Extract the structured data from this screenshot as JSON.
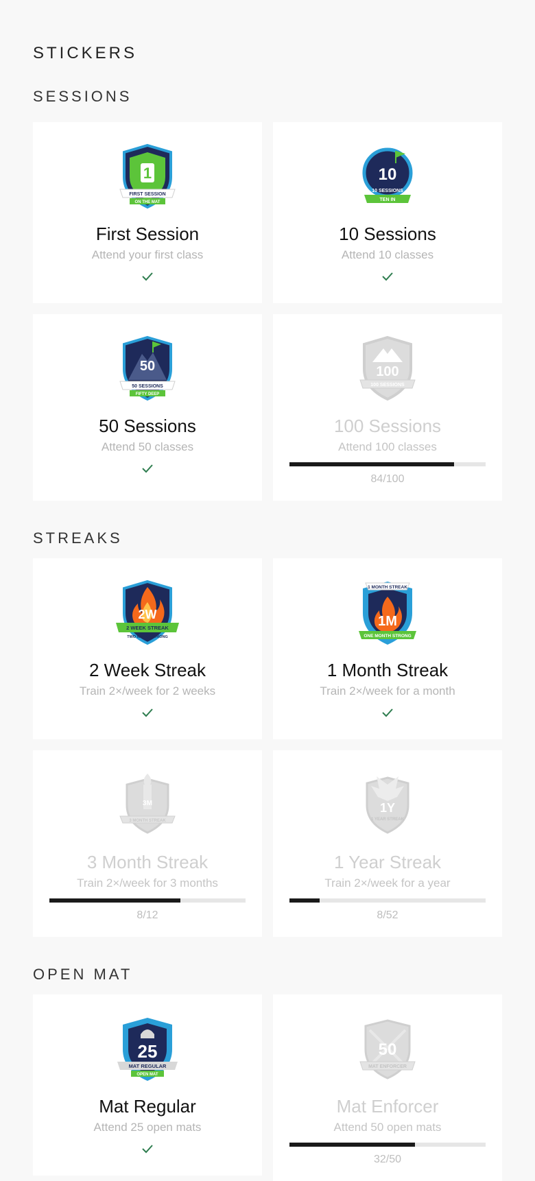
{
  "page": {
    "title": "STICKERS"
  },
  "sections": {
    "sessions": {
      "title": "SESSIONS",
      "cards": [
        {
          "title": "First Session",
          "desc": "Attend your first class",
          "earned": true,
          "badge": {
            "icon": "first-session-badge-icon",
            "big": "1",
            "ribbon": "FIRST SESSION",
            "sub": "ON THE MAT"
          }
        },
        {
          "title": "10 Sessions",
          "desc": "Attend 10 classes",
          "earned": true,
          "badge": {
            "icon": "ten-sessions-badge-icon",
            "big": "10",
            "ribbon": "10 SESSIONS",
            "sub": "TEN IN"
          }
        },
        {
          "title": "50 Sessions",
          "desc": "Attend 50 classes",
          "earned": true,
          "badge": {
            "icon": "fifty-sessions-badge-icon",
            "big": "50",
            "ribbon": "50 SESSIONS",
            "sub": "FIFTY DEEP"
          }
        },
        {
          "title": "100 Sessions",
          "desc": "Attend 100 classes",
          "earned": false,
          "progress": {
            "label": "84/100",
            "fraction": 0.84
          },
          "badge": {
            "icon": "hundred-sessions-badge-icon",
            "big": "100",
            "ribbon": "100 SESSIONS"
          }
        }
      ]
    },
    "streaks": {
      "title": "STREAKS",
      "cards": [
        {
          "title": "2 Week Streak",
          "desc": "Train 2×/week for 2 weeks",
          "earned": true,
          "badge": {
            "icon": "two-week-streak-badge-icon",
            "big": "2W",
            "ribbon": "2 WEEK STREAK",
            "sub": "TWO WEEKS STRONG"
          }
        },
        {
          "title": "1 Month Streak",
          "desc": "Train 2×/week for a month",
          "earned": true,
          "badge": {
            "icon": "one-month-streak-badge-icon",
            "big": "1M",
            "top": "1 MONTH STREAK",
            "ribbon": "ONE MONTH STRONG"
          }
        },
        {
          "title": "3 Month Streak",
          "desc": "Train 2×/week for 3 months",
          "earned": false,
          "progress": {
            "label": "8/12",
            "fraction": 0.667
          },
          "badge": {
            "icon": "three-month-streak-badge-icon",
            "big": "3M",
            "ribbon": "3 MONTH STREAK"
          }
        },
        {
          "title": "1 Year Streak",
          "desc": "Train 2×/week for a year",
          "earned": false,
          "progress": {
            "label": "8/52",
            "fraction": 0.154
          },
          "badge": {
            "icon": "one-year-streak-badge-icon",
            "big": "1Y",
            "ribbon": "1 YEAR STREAK"
          }
        }
      ]
    },
    "open_mat": {
      "title": "OPEN MAT",
      "cards": [
        {
          "title": "Mat Regular",
          "desc": "Attend 25 open mats",
          "earned": true,
          "badge": {
            "icon": "mat-regular-badge-icon",
            "big": "25",
            "ribbon": "MAT REGULAR",
            "sub": "OPEN MAT"
          }
        },
        {
          "title": "Mat Enforcer",
          "desc": "Attend 50 open mats",
          "earned": false,
          "progress": {
            "label": "32/50",
            "fraction": 0.64
          },
          "badge": {
            "icon": "mat-enforcer-badge-icon",
            "big": "50",
            "ribbon": "MAT ENFORCER"
          }
        }
      ]
    }
  },
  "icons": {
    "earned": "check-icon"
  },
  "colors": {
    "check": "#2e7d4f",
    "navy": "#1e2a5a",
    "shield_blue": "#2a9fd8",
    "green": "#5cc43a",
    "flame_orange": "#f5691b",
    "locked_gray": "#d2d2d2",
    "progress_fill": "#1a1a1a",
    "progress_track": "#e6e6e6"
  }
}
